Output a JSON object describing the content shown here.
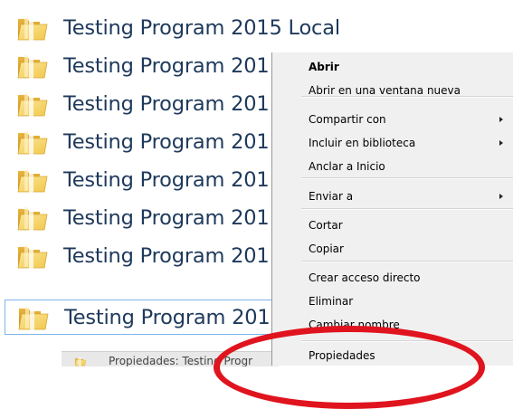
{
  "folders": [
    {
      "label": "Testing Program 2015 Local",
      "selected": false
    },
    {
      "label": "Testing Program 201",
      "selected": false
    },
    {
      "label": "Testing Program 201",
      "selected": false
    },
    {
      "label": "Testing Program 201",
      "selected": false
    },
    {
      "label": "Testing Program 201",
      "selected": false
    },
    {
      "label": "Testing Program 201",
      "selected": false
    },
    {
      "label": "Testing Program 201",
      "selected": false
    },
    {
      "label": "Testing Program 201",
      "selected": true
    }
  ],
  "bottom_strip": {
    "label": "Propiedades: Testing Progr"
  },
  "context_menu": {
    "items": [
      {
        "label": "Abrir",
        "bold": true,
        "submenu": false
      },
      {
        "label": "Abrir en una ventana nueva",
        "bold": false,
        "submenu": false
      },
      {
        "label": "Compartir con",
        "bold": false,
        "submenu": true
      },
      {
        "label": "Incluir en biblioteca",
        "bold": false,
        "submenu": true
      },
      {
        "label": "Anclar a Inicio",
        "bold": false,
        "submenu": false
      },
      {
        "label": "Enviar a",
        "bold": false,
        "submenu": true
      },
      {
        "label": "Cortar",
        "bold": false,
        "submenu": false
      },
      {
        "label": "Copiar",
        "bold": false,
        "submenu": false
      },
      {
        "label": "Crear acceso directo",
        "bold": false,
        "submenu": false
      },
      {
        "label": "Eliminar",
        "bold": false,
        "submenu": false
      },
      {
        "label": "Cambiar nombre",
        "bold": false,
        "submenu": false
      },
      {
        "label": "Propiedades",
        "bold": false,
        "submenu": false
      }
    ]
  },
  "colors": {
    "folder_label": "#1e395b",
    "selection_border": "#7eb4ea",
    "menu_background": "#f0f0f0",
    "annotation": "#e0141e"
  },
  "icons": {
    "folder": "folder-icon",
    "submenu": "submenu-arrow-icon"
  }
}
